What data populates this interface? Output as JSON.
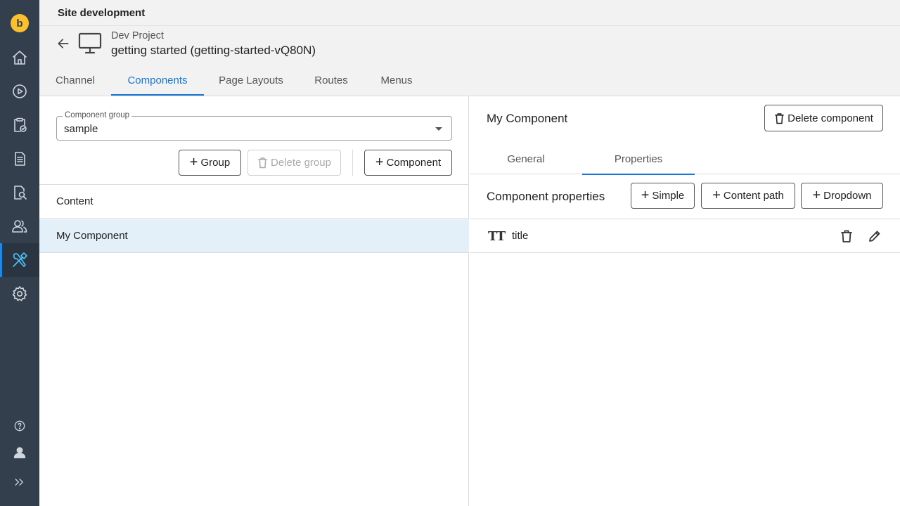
{
  "app": {
    "title": "Site development"
  },
  "sidebar": {
    "logo_text": "b",
    "items": [
      {
        "icon": "home-icon"
      },
      {
        "icon": "play-icon"
      },
      {
        "icon": "clipboard-check-icon"
      },
      {
        "icon": "document-icon"
      },
      {
        "icon": "document-search-icon"
      },
      {
        "icon": "users-icon"
      },
      {
        "icon": "tools-icon",
        "active": true
      },
      {
        "icon": "gear-icon"
      }
    ],
    "bottom": [
      {
        "icon": "help-icon"
      },
      {
        "icon": "user-icon"
      },
      {
        "icon": "expand-icon"
      }
    ]
  },
  "header": {
    "project": "Dev Project",
    "channel": "getting started (getting-started-vQ80N)",
    "tabs": [
      {
        "label": "Channel"
      },
      {
        "label": "Components",
        "active": true
      },
      {
        "label": "Page Layouts"
      },
      {
        "label": "Routes"
      },
      {
        "label": "Menus"
      }
    ]
  },
  "left": {
    "group_field": {
      "label": "Component group",
      "value": "sample"
    },
    "buttons": {
      "group": "Group",
      "delete_group": "Delete group",
      "component": "Component"
    },
    "items": [
      {
        "label": "Content"
      },
      {
        "label": "My Component",
        "selected": true
      }
    ]
  },
  "right": {
    "title": "My Component",
    "delete_button": "Delete component",
    "tabs": [
      {
        "label": "General"
      },
      {
        "label": "Properties",
        "active": true
      }
    ],
    "section_title": "Component properties",
    "add_buttons": {
      "simple": "Simple",
      "content_path": "Content path",
      "dropdown": "Dropdown"
    },
    "properties": [
      {
        "type_icon": "TT",
        "name": "title"
      }
    ]
  },
  "colors": {
    "sidebar": "#333f4d",
    "accent": "#1976d2",
    "logo": "#fbc02d",
    "selected_row": "#e3eff9"
  }
}
